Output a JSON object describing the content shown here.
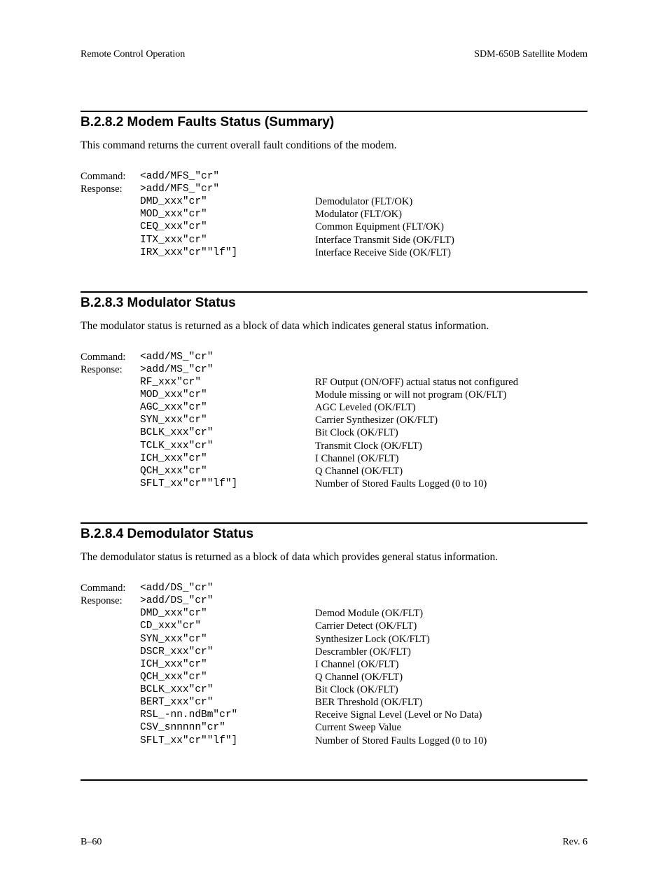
{
  "header": {
    "left": "Remote Control Operation",
    "right": "SDM-650B Satellite Modem"
  },
  "footer": {
    "left": "B–60",
    "right": "Rev. 6"
  },
  "s1": {
    "title": "B.2.8.2  Modem Faults Status (Summary)",
    "para": "This command returns the current overall fault conditions of the modem.",
    "cmdLbl": "Command:",
    "rspLbl": "Response:",
    "cmd": "<add/MFS_\"cr\"",
    "rsp": ">add/MFS_\"cr\"",
    "rows": [
      {
        "c": "DMD_xxx\"cr\"",
        "d": "Demodulator (FLT/OK)"
      },
      {
        "c": "MOD_xxx\"cr\"",
        "d": "Modulator (FLT/OK)"
      },
      {
        "c": "CEQ_xxx\"cr\"",
        "d": "Common Equipment (FLT/OK)"
      },
      {
        "c": "ITX_xxx\"cr\"",
        "d": "Interface Transmit Side (OK/FLT)"
      },
      {
        "c": "IRX_xxx\"cr\"\"lf\"]",
        "d": "Interface Receive Side (OK/FLT)"
      }
    ]
  },
  "s2": {
    "title": "B.2.8.3  Modulator Status",
    "para": "The modulator status is returned as a block of data which indicates general status information.",
    "cmdLbl": "Command:",
    "rspLbl": "Response:",
    "cmd": "<add/MS_\"cr\"",
    "rsp": ">add/MS_\"cr\"",
    "rows": [
      {
        "c": "RF_xxx\"cr\"",
        "d": "RF Output (ON/OFF) actual status not configured"
      },
      {
        "c": "MOD_xxx\"cr\"",
        "d": "Module missing or will not program (OK/FLT)"
      },
      {
        "c": "AGC_xxx\"cr\"",
        "d": "AGC Leveled (OK/FLT)"
      },
      {
        "c": "SYN_xxx\"cr\"",
        "d": "Carrier Synthesizer (OK/FLT)"
      },
      {
        "c": "BCLK_xxx\"cr\"",
        "d": "Bit Clock (OK/FLT)"
      },
      {
        "c": "TCLK_xxx\"cr\"",
        "d": "Transmit Clock (OK/FLT)"
      },
      {
        "c": "ICH_xxx\"cr\"",
        "d": "I Channel (OK/FLT)"
      },
      {
        "c": "QCH_xxx\"cr\"",
        "d": "Q Channel (OK/FLT)"
      },
      {
        "c": "SFLT_xx\"cr\"\"lf\"]",
        "d": "Number of Stored Faults Logged (0 to 10)"
      }
    ]
  },
  "s3": {
    "title": "B.2.8.4  Demodulator Status",
    "para": "The demodulator status is returned as a block of data which provides general status information.",
    "cmdLbl": "Command:",
    "rspLbl": "Response:",
    "cmd": "<add/DS_\"cr\"",
    "rsp": ">add/DS_\"cr\"",
    "rows": [
      {
        "c": "DMD_xxx\"cr\"",
        "d": "Demod Module (OK/FLT)"
      },
      {
        "c": "CD_xxx\"cr\"",
        "d": "Carrier Detect (OK/FLT)"
      },
      {
        "c": "SYN_xxx\"cr\"",
        "d": "Synthesizer Lock (OK/FLT)"
      },
      {
        "c": "DSCR_xxx\"cr\"",
        "d": "Descrambler (OK/FLT)"
      },
      {
        "c": "ICH_xxx\"cr\"",
        "d": "I Channel (OK/FLT)"
      },
      {
        "c": "QCH_xxx\"cr\"",
        "d": "Q Channel (OK/FLT)"
      },
      {
        "c": "BCLK_xxx\"cr\"",
        "d": "Bit Clock (OK/FLT)"
      },
      {
        "c": "BERT_xxx\"cr\"",
        "d": "BER Threshold (OK/FLT)"
      },
      {
        "c": "RSL_-nn.ndBm\"cr\"",
        "d": "Receive Signal Level (Level or No Data)"
      },
      {
        "c": "CSV_snnnnn\"cr\"",
        "d": "Current Sweep Value"
      },
      {
        "c": "SFLT_xx\"cr\"\"lf\"]",
        "d": "Number of Stored Faults Logged (0 to 10)"
      }
    ]
  }
}
